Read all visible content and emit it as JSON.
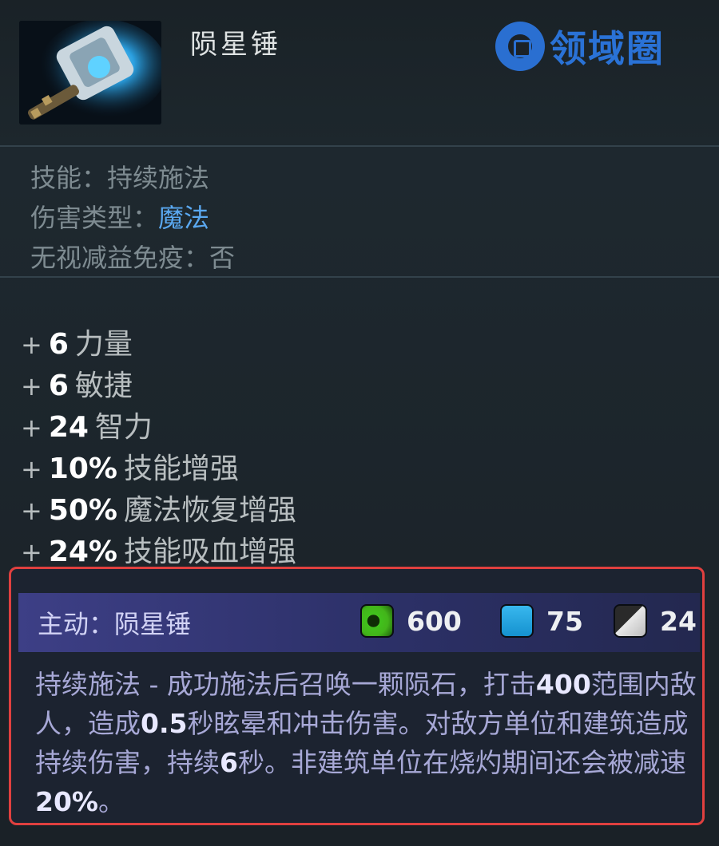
{
  "item": {
    "title": "陨星锤"
  },
  "watermark": {
    "text": "领域圈",
    "color": "#2a72d6"
  },
  "properties": {
    "skill_label": "技能：",
    "skill_value": "持续施法",
    "damage_label": "伤害类型：",
    "damage_value": "魔法",
    "immunity_label": "无视减益免疫：",
    "immunity_value": "否"
  },
  "stats": [
    {
      "plus": "+",
      "value": "6",
      "name": "力量"
    },
    {
      "plus": "+",
      "value": "6",
      "name": "敏捷"
    },
    {
      "plus": "+",
      "value": "24",
      "name": "智力"
    },
    {
      "plus": "+",
      "value": "10%",
      "name": "技能增强"
    },
    {
      "plus": "+",
      "value": "50%",
      "name": "魔法恢复增强"
    },
    {
      "plus": "+",
      "value": "24%",
      "name": "技能吸血增强"
    }
  ],
  "active": {
    "title": "主动：陨星锤",
    "cast_range": "600",
    "mana_cost": "75",
    "cooldown": "24",
    "desc": {
      "p1": "持续施法 - 成功施法后召唤一颗陨石，打击",
      "radius": "400",
      "p2": "范围内敌人，造成",
      "stun": "0.5",
      "p3": "秒眩晕和冲击伤害。对敌方单位和建筑造成持续伤害，持续",
      "duration": "6",
      "p4": "秒。非建筑单位在烧灼期间还会被减速",
      "slow": "20%",
      "p5": "。"
    }
  },
  "colors": {
    "highlight_border": "#e0403f",
    "magic_value": "#5aa8f0",
    "active_header": "#3d3f86"
  }
}
